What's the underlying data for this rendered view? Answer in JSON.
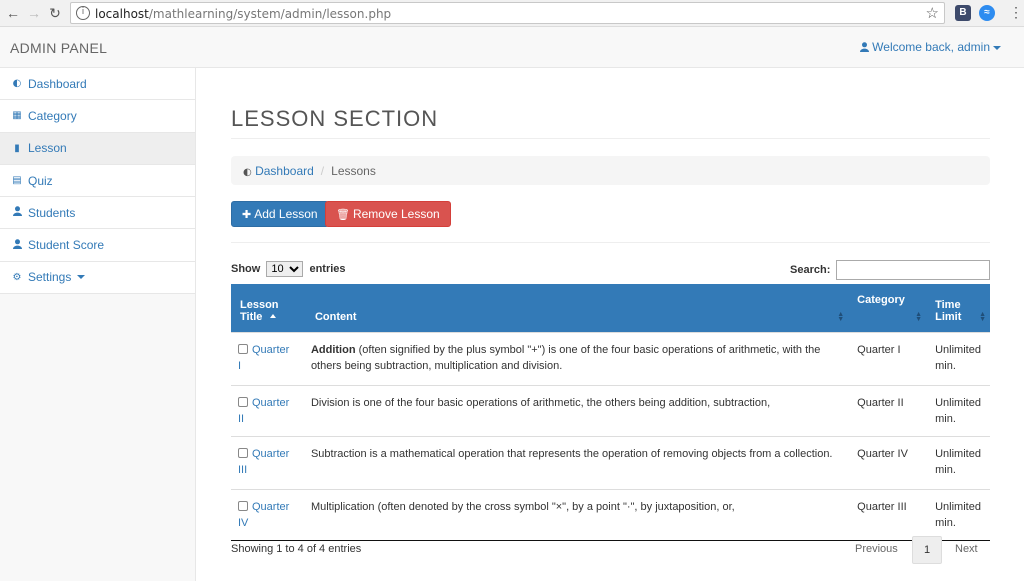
{
  "browser": {
    "url_host": "localhost",
    "url_path": "/mathlearning/system/admin/lesson.php",
    "ext1_label": "B"
  },
  "navbar": {
    "brand": "ADMIN PANEL",
    "welcome": "Welcome back, admin"
  },
  "sidebar": {
    "items": [
      {
        "label": "Dashboard",
        "icon": "dashboard-icon"
      },
      {
        "label": "Category",
        "icon": "table-icon"
      },
      {
        "label": "Lesson",
        "icon": "bar-chart-icon"
      },
      {
        "label": "Quiz",
        "icon": "list-alt-icon"
      },
      {
        "label": "Students",
        "icon": "user-icon"
      },
      {
        "label": "Student Score",
        "icon": "user-icon"
      },
      {
        "label": "Settings",
        "icon": "gear-icon"
      }
    ]
  },
  "main": {
    "title": "LESSON SECTION",
    "breadcrumb_home": "Dashboard",
    "breadcrumb_current": "Lessons",
    "add_label": "Add Lesson",
    "remove_label": "Remove Lesson",
    "show_label": "Show",
    "show_value": "10",
    "entries_label": "entries",
    "search_label": "Search:"
  },
  "table": {
    "headers": [
      "Lesson Title",
      "Content",
      "Category",
      "Time Limit"
    ],
    "header_lines": {
      "c1a": "Lesson",
      "c1b": "Title",
      "c4a": "Time",
      "c4b": "Limit"
    },
    "rows": [
      {
        "title_a": "Quarter",
        "title_b": "I",
        "content_bold": "Addition",
        "content": " (often signified by the plus symbol \"+\") is one of the four basic operations of arithmetic, with the others being subtraction, multiplication and division.",
        "category": "Quarter I",
        "limit_a": "Unlimited",
        "limit_b": "min."
      },
      {
        "title_a": "Quarter",
        "title_b": "II",
        "content_bold": "",
        "content": "Division is one of the four basic operations of arithmetic, the others being addition, subtraction,",
        "category": "Quarter II",
        "limit_a": "Unlimited",
        "limit_b": "min."
      },
      {
        "title_a": "Quarter",
        "title_b": "III",
        "content_bold": "",
        "content": "Subtraction is a mathematical operation that represents the operation of removing objects from a collection.",
        "category": "Quarter IV",
        "limit_a": "Unlimited",
        "limit_b": "min."
      },
      {
        "title_a": "Quarter",
        "title_b": "IV",
        "content_bold": "",
        "content": "Multiplication (often denoted by the cross symbol \"×\", by a point \"·\", by juxtaposition, or,",
        "category": "Quarter III",
        "limit_a": "Unlimited",
        "limit_b": "min."
      }
    ]
  },
  "footer": {
    "info": "Showing 1 to 4 of 4 entries",
    "prev": "Previous",
    "page": "1",
    "next": "Next"
  }
}
